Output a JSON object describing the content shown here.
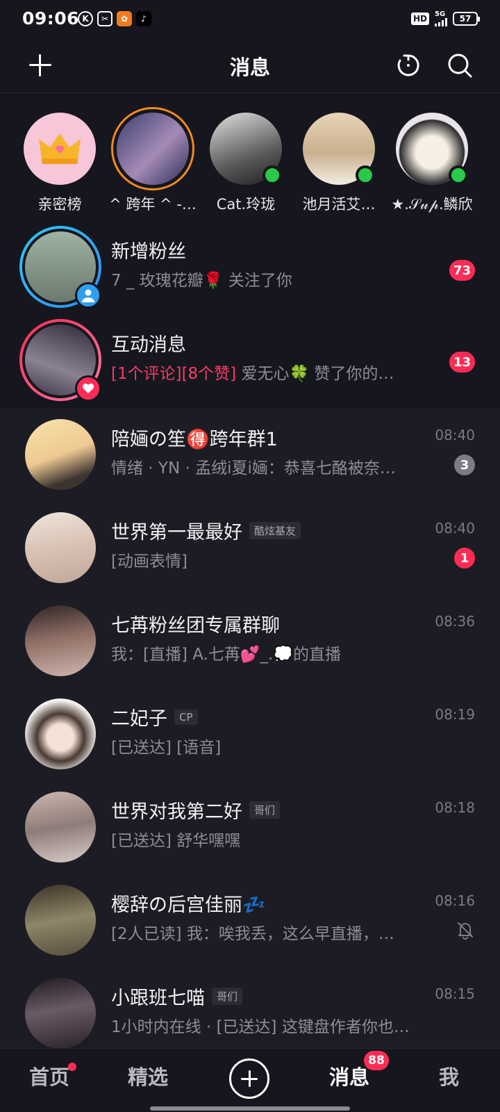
{
  "status_bar": {
    "time": "09:06",
    "hd": "HD",
    "network": "5G",
    "battery": "57"
  },
  "header": {
    "title": "消息"
  },
  "stories": [
    {
      "name": "亲密榜",
      "color": "#f7c6d8"
    },
    {
      "name": "^ 跨年 ^ -…",
      "color": "#5a4f82",
      "ring": true
    },
    {
      "name": "Cat.玲珑",
      "color": "#9b9b9b",
      "online": true
    },
    {
      "name": "池月活艾…",
      "color": "#d9c8a8",
      "online": true
    },
    {
      "name": "★.𝒮𝓊𝓅.鳞欣",
      "color": "#e9e3ea",
      "online": true
    }
  ],
  "special_rows": [
    {
      "title": "新增粉丝",
      "subtitle": "7 _ 玫瑰花瓣🌹 关注了你",
      "badge": "73",
      "avatar_color": "#7a8f7d"
    },
    {
      "title": "互动消息",
      "subtitle_pink": "[1个评论][8个赞]",
      "subtitle": " 爱无心🍀 赞了你的…",
      "badge": "13",
      "avatar_color": "#4a4452"
    }
  ],
  "chats": [
    {
      "title": "陪婳の笙🉐跨年群1",
      "tag": "",
      "subtitle": "情绪 · YN · 孟绒i夏i婳：恭喜七酪被奈…",
      "time": "08:40",
      "badge": "3",
      "badge_grey": true,
      "avatar_color": "#f1dba2"
    },
    {
      "title": "世界第一最最好",
      "tag": "酷炫基友",
      "subtitle": "[动画表情]",
      "time": "08:40",
      "badge": "1",
      "avatar_color": "#e6d6cc"
    },
    {
      "title": "七苒粉丝团专属群聊",
      "tag": "",
      "subtitle": "我：[直播] A.七苒💕_.💭的直播",
      "time": "08:36",
      "badge": "",
      "avatar_color": "#5a4a48"
    },
    {
      "title": "二妃子",
      "tag": "CP",
      "subtitle": "[已送达] [语音]",
      "time": "08:19",
      "badge": "",
      "avatar_color": "#f3eee8"
    },
    {
      "title": "世界对我第二好",
      "tag": "哥们",
      "subtitle": "[已送达] 舒华嘿嘿",
      "time": "08:18",
      "badge": "",
      "avatar_color": "#d4c3bd"
    },
    {
      "title": "樱辞の后宫佳丽💤",
      "tag": "",
      "subtitle": "[2人已读] 我：唉我丢，这么早直播，…",
      "time": "08:16",
      "badge": "",
      "muted": true,
      "avatar_color": "#6e6650"
    },
    {
      "title": "小跟班七喵",
      "tag": "哥们",
      "subtitle": "1小时内在线 · [已送达] 这键盘作者你也…",
      "time": "08:15",
      "badge": "",
      "avatar_color": "#4a3a44"
    }
  ],
  "bottom_nav": {
    "home": "首页",
    "featured": "精选",
    "messages": "消息",
    "messages_badge": "88",
    "me": "我"
  }
}
